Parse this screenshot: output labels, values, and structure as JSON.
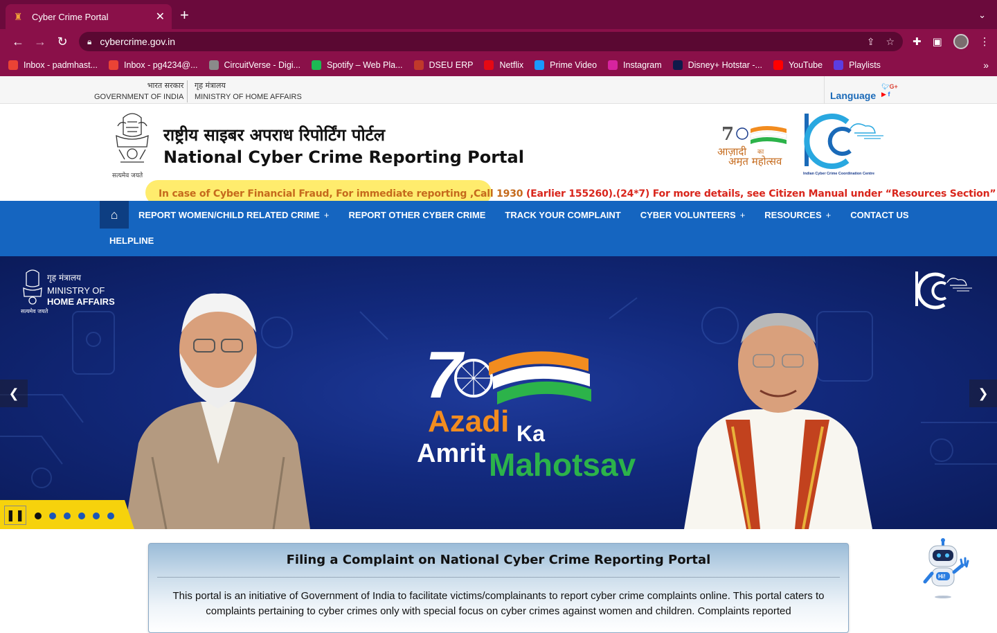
{
  "browser": {
    "tab_title": "Cyber Crime Portal",
    "url": "cybercrime.gov.in",
    "bookmarks": [
      {
        "label": "Inbox - padmhast...",
        "color": "#ea4335",
        "icon": "gmail-icon"
      },
      {
        "label": "Inbox - pg4234@...",
        "color": "#ea4335",
        "icon": "gmail-icon"
      },
      {
        "label": "CircuitVerse - Digi...",
        "color": "#8a8a8a",
        "icon": "circuitverse-icon"
      },
      {
        "label": "Spotify – Web Pla...",
        "color": "#1db954",
        "icon": "spotify-icon"
      },
      {
        "label": "DSEU ERP",
        "color": "#c0392b",
        "icon": "dseu-icon"
      },
      {
        "label": "Netflix",
        "color": "#e50914",
        "icon": "netflix-icon"
      },
      {
        "label": "Prime Video",
        "color": "#1a98ff",
        "icon": "prime-video-icon"
      },
      {
        "label": "Instagram",
        "color": "#d6249f",
        "icon": "instagram-icon"
      },
      {
        "label": "Disney+ Hotstar -...",
        "color": "#0f1a4a",
        "icon": "hotstar-icon"
      },
      {
        "label": "YouTube",
        "color": "#ff0000",
        "icon": "youtube-icon"
      },
      {
        "label": "Playlists",
        "color": "#5b3de0",
        "icon": "playlists-icon"
      }
    ]
  },
  "gov_strip": {
    "gov_hi": "भारत सरकार",
    "gov_en": "GOVERNMENT OF INDIA",
    "mha_hi": "गृह मंत्रालय",
    "mha_en": "MINISTRY OF HOME AFFAIRS",
    "language": "Language"
  },
  "header": {
    "emblem_caption": "सत्यमेव जयते",
    "title_hi": "राष्ट्रीय साइबर अपराध रिपोर्टिंग पोर्टल",
    "title_en": "National Cyber Crime Reporting Portal",
    "azadi_hi_1": "आज़ादी",
    "azadi_hi_ka": "का",
    "azadi_hi_2": "अमृत महोत्सव",
    "icc_caption": "Indian Cyber Crime Coordination Centre",
    "ticker_part1": "In case of Cyber Financial Fraud, For immediate reporting ,Call 1930",
    "ticker_part2": " (Earlier 155260).(24*7) For more details, see Citizen Manual under “Resources Section”"
  },
  "nav": {
    "items": [
      {
        "label": "REPORT WOMEN/CHILD RELATED CRIME",
        "has_sub": true
      },
      {
        "label": "REPORT OTHER CYBER CRIME",
        "has_sub": false
      },
      {
        "label": "TRACK YOUR COMPLAINT",
        "has_sub": false
      },
      {
        "label": "CYBER VOLUNTEERS",
        "has_sub": true
      },
      {
        "label": "RESOURCES",
        "has_sub": true
      },
      {
        "label": "CONTACT US",
        "has_sub": false
      }
    ],
    "helpline": "HELPLINE",
    "plus": "+"
  },
  "banner": {
    "mha_hi": "गृह मंत्रालय",
    "mha_en1": "MINISTRY OF",
    "mha_en2": "HOME AFFAIRS",
    "mha_motto": "सत्यमेव जयते",
    "azadi": "Azadi",
    "ka": "Ka",
    "amrit": "Amrit",
    "mahotsav": "Mahotsav",
    "slide_count": 6,
    "active_slide": 1
  },
  "info": {
    "heading": "Filing a Complaint on National Cyber Crime Reporting Portal",
    "body": "This portal is an initiative of Government of India to facilitate victims/complainants to report cyber crime complaints online. This portal caters to complaints pertaining to cyber crimes only with special focus on cyber crimes against women and children. Complaints reported"
  },
  "chatbot": {
    "label": "Hi!"
  }
}
